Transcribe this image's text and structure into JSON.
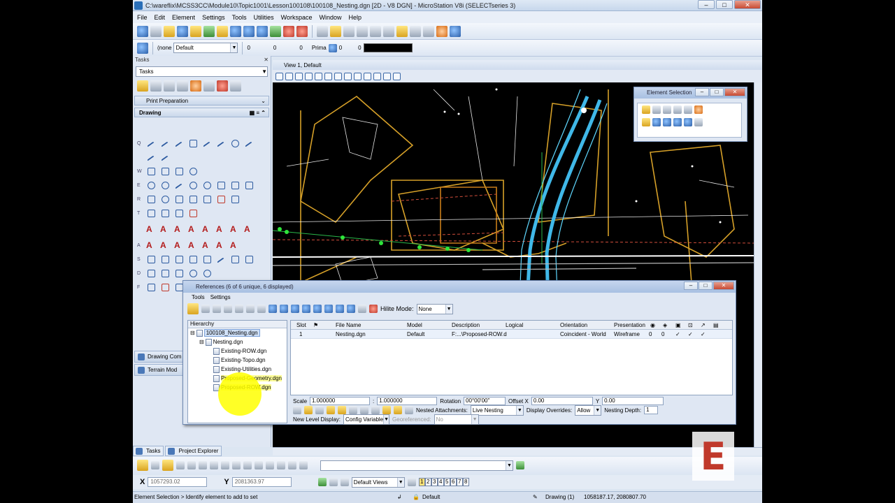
{
  "window": {
    "title": "C:\\wareflix\\MCSS3CC\\Module10\\Topic1001\\Lesson100108\\100108_Nesting.dgn [2D - V8 DGN] - MicroStation V8i (SELECTseries 3)"
  },
  "menu": [
    "File",
    "Edit",
    "Element",
    "Settings",
    "Tools",
    "Utilities",
    "Workspace",
    "Window",
    "Help"
  ],
  "attributes": {
    "color_value": "(none",
    "level": "Default",
    "style_value": "0",
    "weight_value": "0",
    "line_value": "0",
    "class": "Prima",
    "transparency": "0",
    "priority": "0"
  },
  "tasks": {
    "header": "Tasks",
    "select_value": "Tasks",
    "print_prep": "Print Preparation",
    "drawing": "Drawing",
    "row_letters": [
      "Q",
      "W",
      "E",
      "R",
      "T",
      "A",
      "S",
      "D",
      "F"
    ],
    "drawing_comp": "Drawing Com",
    "terrain": "Terrain Mod"
  },
  "view": {
    "title": "View 1, Default"
  },
  "element_selection": {
    "title": "Element Selection"
  },
  "references": {
    "title": "References (6 of 6 unique, 6 displayed)",
    "menu": [
      "Tools",
      "Settings"
    ],
    "hilite_label": "Hilite Mode:",
    "hilite_value": "None",
    "hierarchy_header": "Hierarchy",
    "tree": [
      {
        "label": "100108_Nesting.dgn",
        "level": 0,
        "state": "selected"
      },
      {
        "label": "Nesting.dgn",
        "level": 1,
        "state": ""
      },
      {
        "label": "Existing-ROW.dgn",
        "level": 2,
        "state": ""
      },
      {
        "label": "Existing-Topo.dgn",
        "level": 2,
        "state": ""
      },
      {
        "label": "Existing-Utilities.dgn",
        "level": 2,
        "state": ""
      },
      {
        "label": "Proposed-Geometry.dgn",
        "level": 2,
        "state": "highlight"
      },
      {
        "label": "Proposed-ROW.dgn",
        "level": 2,
        "state": "highlight"
      }
    ],
    "columns": [
      "Slot",
      "File Name",
      "Model",
      "Description",
      "Logical",
      "Orientation",
      "Presentation"
    ],
    "row": {
      "slot": "1",
      "file": "Nesting.dgn",
      "model": "Default",
      "desc": "F:...\\Proposed-ROW.d",
      "logical": "",
      "orientation": "Coincident - World",
      "presentation": "Wireframe",
      "c1": "0",
      "c2": "0",
      "c3": "✓",
      "c4": "✓",
      "c5": "✓"
    },
    "scale_label": "Scale",
    "scale_a": "1.000000",
    "scale_b": "1.000000",
    "rotation_label": "Rotation",
    "rotation_value": "00°00'00\"",
    "offset_x_label": "Offset X",
    "offset_x_value": "0.00",
    "y_label": "Y",
    "y_value": "0.00",
    "nested_label": "Nested Attachments:",
    "nested_value": "Live Nesting",
    "overrides_label": "Display Overrides:",
    "overrides_value": "Allow",
    "depth_label": "Nesting Depth:",
    "depth_value": "1",
    "newlevel_label": "New Level Display:",
    "newlevel_value": "Config Variable",
    "georef_label": "Georeferenced:",
    "georef_value": "No"
  },
  "bottom_tabs": [
    "Tasks",
    "Project Explorer"
  ],
  "coords": {
    "x_label": "X",
    "x_value": "1057293.02",
    "y_label": "Y",
    "y_value": "2081363.97",
    "views_label": "Default Views",
    "views": [
      "1",
      "2",
      "3",
      "4",
      "5",
      "6",
      "7",
      "8"
    ]
  },
  "status": {
    "prompt": "Element Selection > Identify element to add to set",
    "level": "Default",
    "model": "Drawing (1)",
    "coords": "1058187.17, 2080807.70"
  },
  "colors": {
    "accent": "#2a6fb8",
    "highlight": "#ffff00",
    "cad_orange": "#d6a028",
    "cad_cyan": "#40b8e8"
  }
}
